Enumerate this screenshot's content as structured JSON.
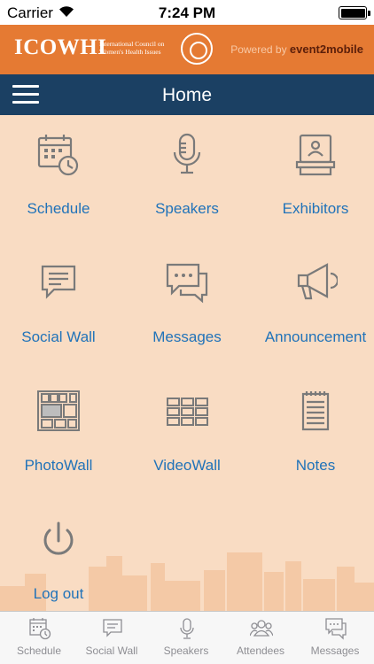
{
  "status_bar": {
    "carrier": "Carrier",
    "time": "7:24 PM"
  },
  "brand": {
    "logo": "ICOWHI",
    "logo_subtitle": "International Council on Women's Health Issues",
    "powered_by": "Powered by ",
    "powered_brand": "event2mobile",
    "color": "#e57a33"
  },
  "nav": {
    "title": "Home",
    "color": "#1b4063"
  },
  "grid": {
    "label_color": "#2173b9",
    "icon_color": "#7a7a7a",
    "items": [
      {
        "label": "Schedule",
        "icon": "calendar-clock-icon"
      },
      {
        "label": "Speakers",
        "icon": "microphone-icon"
      },
      {
        "label": "Exhibitors",
        "icon": "exhibitor-booth-icon"
      },
      {
        "label": "Social Wall",
        "icon": "chat-bubble-icon"
      },
      {
        "label": "Messages",
        "icon": "messages-icon"
      },
      {
        "label": "Announcement",
        "icon": "megaphone-icon"
      },
      {
        "label": "PhotoWall",
        "icon": "photo-collage-icon"
      },
      {
        "label": "VideoWall",
        "icon": "video-grid-icon"
      },
      {
        "label": "Notes",
        "icon": "notepad-icon"
      },
      {
        "label": "Log out",
        "icon": "power-icon"
      }
    ]
  },
  "tab_bar": {
    "items": [
      {
        "label": "Schedule",
        "icon": "calendar-clock-icon"
      },
      {
        "label": "Social Wall",
        "icon": "chat-bubble-icon"
      },
      {
        "label": "Speakers",
        "icon": "microphone-icon"
      },
      {
        "label": "Attendees",
        "icon": "people-icon"
      },
      {
        "label": "Messages",
        "icon": "messages-icon"
      }
    ]
  }
}
